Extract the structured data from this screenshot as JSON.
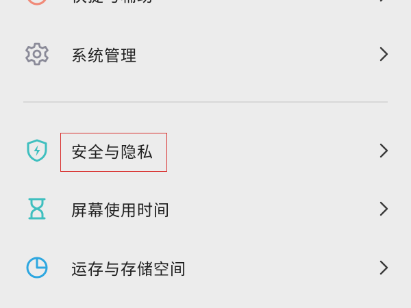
{
  "settings": {
    "items": [
      {
        "label": "快捷与辅助",
        "icon": "accessibility-icon"
      },
      {
        "label": "系统管理",
        "icon": "gear-icon"
      },
      {
        "label": "安全与隐私",
        "icon": "shield-icon"
      },
      {
        "label": "屏幕使用时间",
        "icon": "hourglass-icon"
      },
      {
        "label": "运存与存储空间",
        "icon": "storage-pie-icon"
      }
    ]
  },
  "colors": {
    "background": "#ececec",
    "accessibility_icon": "#f08a78",
    "gear_icon": "#8a8a98",
    "shield_icon": "#3fbfbf",
    "hourglass_icon": "#3fbfbf",
    "storage_icon": "#2ea7e0",
    "highlight_border": "#d9312f"
  }
}
